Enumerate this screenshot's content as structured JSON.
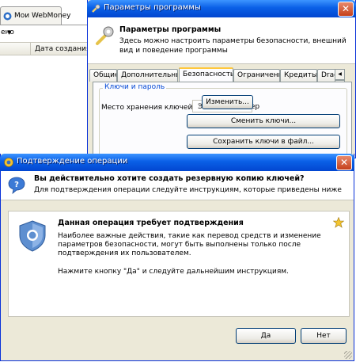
{
  "background_window": {
    "tab_label": "Мои WebMoney",
    "toolbar_label": "ено",
    "column_header": "Дата создания"
  },
  "settings_window": {
    "title": "Параметры программы",
    "header_title": "Параметры программы",
    "header_desc": "Здесь можно настроить параметры безопасности, внешний вид и поведение программы",
    "tabs": [
      "Общие",
      "Дополнительные",
      "Безопасность",
      "Ограничения",
      "Кредиты",
      "Drag"
    ],
    "selected_tab": "Безопасность",
    "group_label": "Ключи и пароль",
    "key_storage_label": "Место хранения ключей:",
    "key_storage_value": "Этот компьютер",
    "change_button": "Изменить...",
    "change_keys_button": "Сменить ключи...",
    "save_keys_button": "Сохранить ключи в файл..."
  },
  "confirm_dialog": {
    "title": "Подтверждение операции",
    "question": "Вы действительно хотите создать резервную копию ключей?",
    "instruction": "Для подтверждения операции следуйте инструкциям, которые приведены ниже",
    "message_title": "Данная операция требует подтверждения",
    "message_body": "Наиболее важные действия, такие как перевод средств и изменение параметров безопасности, могут быть выполнены только после подтверждения их пользователем.",
    "message_hint": "Нажмите кнопку \"Да\" и следуйте дальнейшим инструкциям.",
    "yes_button": "Да",
    "no_button": "Нет"
  },
  "colors": {
    "titlebar_blue": "#0a5fe6",
    "dialog_face": "#ece9d8",
    "selected_tab_accent": "#ffc83c",
    "close_button_red": "#c5401b",
    "group_label_blue": "#0046d5"
  }
}
